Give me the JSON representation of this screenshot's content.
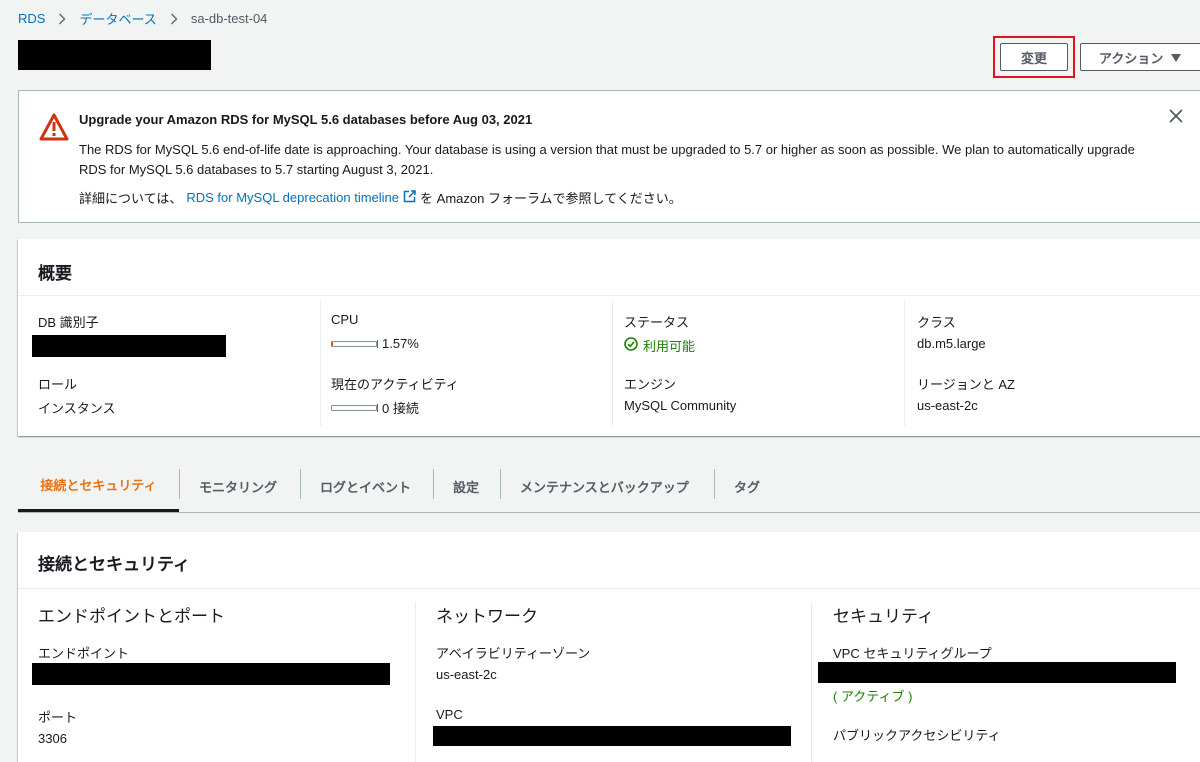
{
  "breadcrumb": {
    "items": [
      "RDS",
      "データベース",
      "sa-db-test-04"
    ]
  },
  "header": {
    "modify_label": "変更",
    "actions_label": "アクション"
  },
  "alert": {
    "title": "Upgrade your Amazon RDS for MySQL 5.6 databases before Aug 03, 2021",
    "body": "The RDS for MySQL 5.6 end-of-life date is approaching. Your database is using a version that must be upgraded to 5.7 or higher as soon as possible. We plan to automatically upgrade RDS for MySQL 5.6 databases to 5.7 starting August 3, 2021.",
    "more_prefix": "詳細については、",
    "more_link": "RDS for MySQL deprecation timeline",
    "more_suffix": "を Amazon フォーラムで参照してください。"
  },
  "summary": {
    "title": "概要",
    "db_id_label": "DB 識別子",
    "role_label": "ロール",
    "role_value": "インスタンス",
    "cpu_label": "CPU",
    "cpu_value": "1.57%",
    "cpu_fraction": 0.0157,
    "activity_label": "現在のアクティビティ",
    "activity_value": "0 接続",
    "activity_fraction": 0,
    "status_label": "ステータス",
    "status_value": "利用可能",
    "engine_label": "エンジン",
    "engine_value": "MySQL Community",
    "class_label": "クラス",
    "class_value": "db.m5.large",
    "region_label": "リージョンと AZ",
    "region_value": "us-east-2c"
  },
  "tabs": [
    {
      "label": "接続とセキュリティ",
      "active": true
    },
    {
      "label": "モニタリング",
      "active": false
    },
    {
      "label": "ログとイベント",
      "active": false
    },
    {
      "label": "設定",
      "active": false
    },
    {
      "label": "メンテナンスとバックアップ",
      "active": false
    },
    {
      "label": "タグ",
      "active": false
    }
  ],
  "connectivity": {
    "title": "接続とセキュリティ",
    "endpoint_section": "エンドポイントとポート",
    "endpoint_label": "エンドポイント",
    "port_label": "ポート",
    "port_value": "3306",
    "network_section": "ネットワーク",
    "az_label": "アベイラビリティーゾーン",
    "az_value": "us-east-2c",
    "vpc_label": "VPC",
    "security_section": "セキュリティ",
    "sg_label": "VPC セキュリティグループ",
    "sg_status": "( アクティブ )",
    "public_label": "パブリックアクセシビリティ"
  },
  "colors": {
    "link": "#0073bb",
    "active_tab": "#ec7211",
    "success": "#1d8102",
    "warning": "#d13212",
    "highlight": "#e0131b"
  }
}
